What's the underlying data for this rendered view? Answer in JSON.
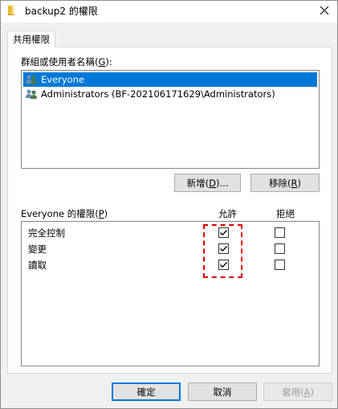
{
  "window": {
    "title": "backup2 的權限",
    "folder_icon": "folder-icon",
    "close_icon": "close-icon"
  },
  "tab": {
    "label": "共用權限"
  },
  "users_section": {
    "label_prefix": "群組或使用者名稱(",
    "label_key": "G",
    "label_suffix": "):",
    "items": [
      {
        "name": "Everyone",
        "icon": "user-group-icon",
        "selected": true
      },
      {
        "name": "Administrators (BF-202106171629\\Administrators)",
        "icon": "user-group-icon",
        "selected": false
      }
    ]
  },
  "buttons": {
    "add_prefix": "新增(",
    "add_key": "D",
    "add_suffix": ")...",
    "remove_prefix": "移除(",
    "remove_key": "R",
    "remove_suffix": ")"
  },
  "permissions": {
    "header_prefix": "Everyone 的權限(",
    "header_key": "P",
    "header_suffix": ")",
    "allow_header": "允許",
    "deny_header": "拒絕",
    "rows": [
      {
        "name": "完全控制",
        "allow": true,
        "deny": false
      },
      {
        "name": "變更",
        "allow": true,
        "deny": false
      },
      {
        "name": "讀取",
        "allow": true,
        "deny": false
      }
    ]
  },
  "footer": {
    "ok": "確定",
    "cancel": "取消",
    "apply_prefix": "套用(",
    "apply_key": "A",
    "apply_suffix": ")"
  },
  "colors": {
    "selection": "#0078d7",
    "highlight": "#e00000"
  }
}
